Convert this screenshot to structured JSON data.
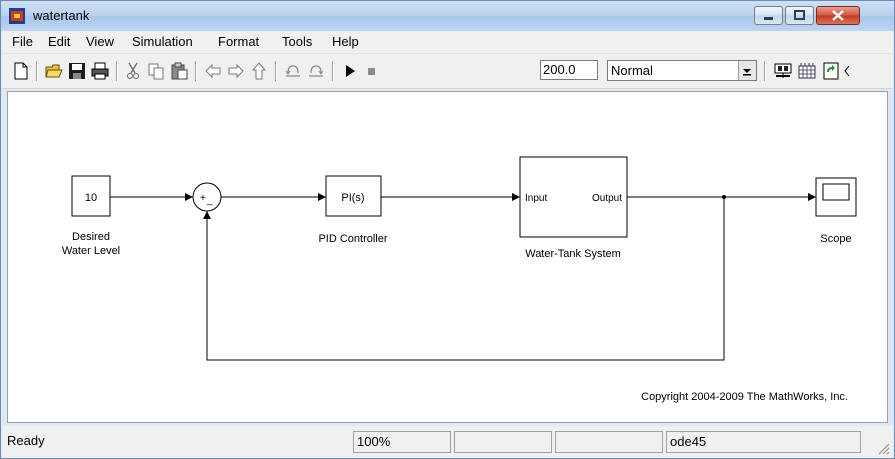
{
  "window": {
    "title": "watertank"
  },
  "menu": [
    "File",
    "Edit",
    "View",
    "Simulation",
    "Format",
    "Tools",
    "Help"
  ],
  "toolbar": {
    "stop_time": "200.0",
    "sim_mode": "Normal"
  },
  "model": {
    "constant": {
      "value": "10",
      "label_line1": "Desired",
      "label_line2": "Water Level"
    },
    "sum": {
      "plus": "+",
      "minus": "_"
    },
    "pid": {
      "block_text": "PI(s)",
      "label": "PID Controller"
    },
    "tank": {
      "input": "Input",
      "output": "Output",
      "label": "Water-Tank System"
    },
    "scope": {
      "label": "Scope"
    },
    "copyright": "Copyright 2004-2009 The MathWorks, Inc."
  },
  "status": {
    "state": "Ready",
    "zoom": "100%",
    "solver": "ode45"
  }
}
